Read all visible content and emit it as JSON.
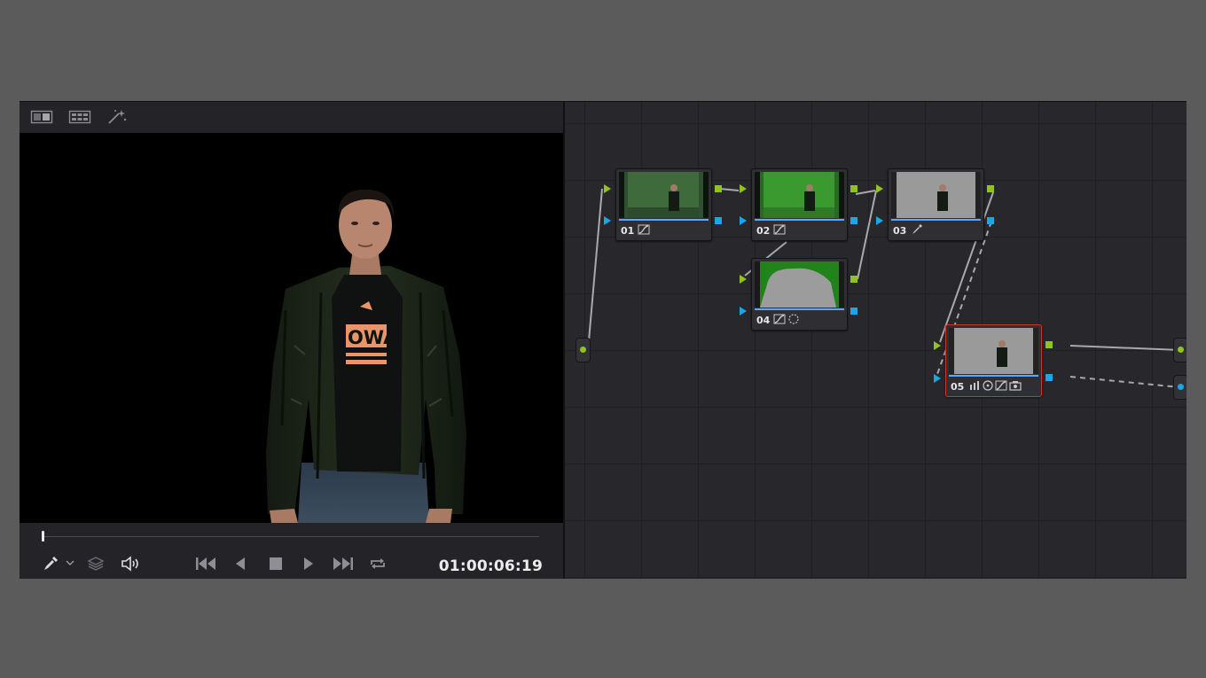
{
  "viewer": {
    "toolbar": {
      "icons": [
        "split-screen-icon",
        "gallery-grid-icon",
        "magic-wand-icon"
      ]
    },
    "playhead_position": 0.0,
    "transport": {
      "icons": [
        "eyedropper-icon",
        "chevron-down-icon",
        "layers-icon",
        "speaker-icon",
        "skip-to-start-icon",
        "play-reverse-icon",
        "stop-icon",
        "play-icon",
        "skip-to-end-icon",
        "loop-icon"
      ],
      "timecode": "01:00:06:19"
    }
  },
  "node_graph": {
    "nodes": [
      {
        "label": "01",
        "tools": [
          "curves-icon"
        ],
        "thumb": "green-screen"
      },
      {
        "label": "02",
        "tools": [
          "curves-icon"
        ],
        "thumb": "green-screen-bright"
      },
      {
        "label": "03",
        "tools": [
          "eyedropper-icon"
        ],
        "thumb": "gray-key"
      },
      {
        "label": "04",
        "tools": [
          "curves-icon",
          "window-icon"
        ],
        "thumb": "matte"
      },
      {
        "label": "05",
        "tools": [
          "histogram-icon",
          "target-icon",
          "curves-icon",
          "key-icon"
        ],
        "thumb": "gray-key",
        "selected": true
      }
    ]
  },
  "colors": {
    "rgb_port": "#8fc31f",
    "alpha_port": "#1ca6e8",
    "selected_border": "#d0342c",
    "thumb_bar": "#5da8ff"
  }
}
